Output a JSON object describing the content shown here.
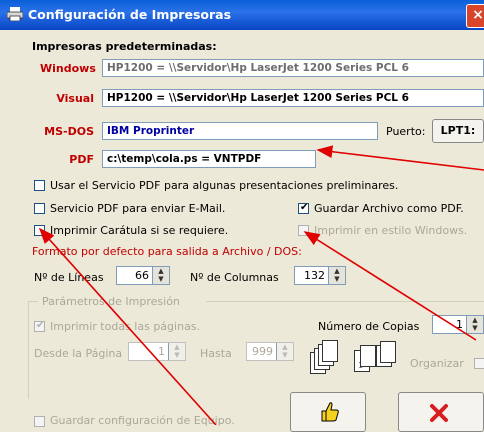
{
  "window": {
    "title": "Configuración de Impresoras",
    "close_glyph": "×"
  },
  "section_title": "Impresoras predeterminadas:",
  "printers": {
    "windows_label": "Windows",
    "windows_value": "HP1200 = \\\\Servidor\\Hp LaserJet 1200 Series PCL 6",
    "visual_label": "Visual",
    "visual_value": "HP1200 = \\\\Servidor\\Hp LaserJet 1200 Series PCL 6",
    "msdos_label": "MS-DOS",
    "msdos_value": "IBM Proprinter",
    "port_label": "Puerto:",
    "port_value": "LPT1:",
    "pdf_label": "PDF",
    "pdf_value": "c:\\temp\\cola.ps = VNTPDF"
  },
  "options": {
    "use_pdf_service": "Usar el Servicio PDF para algunas presentaciones preliminares.",
    "pdf_email": "Servicio PDF para enviar E-Mail.",
    "save_as_pdf": "Guardar Archivo como PDF.",
    "print_cover": "Imprimir Carátula si se requiere.",
    "print_windows_style": "Imprimir en estilo Windows."
  },
  "default_format_title": "Formato por defecto para salida a Archivo / DOS:",
  "format": {
    "lines_label": "Nº de Líneas",
    "lines_value": "66",
    "cols_label": "Nº de Columnas",
    "cols_value": "132"
  },
  "print_params": {
    "group_title": "Parámetros de Impresión",
    "print_all_pages": "Imprimir todas las páginas.",
    "copies_label": "Número de Copias",
    "copies_value": "1",
    "from_label": "Desde la Página",
    "from_value": "1",
    "to_label": "Hasta",
    "to_value": "999",
    "collate_label": "Organizar",
    "doc_num_1": "1",
    "doc_num_2": "2"
  },
  "footer": {
    "save_config_label": "Guardar configuración de Equipo."
  },
  "icons": {
    "ok": "thumbs-up-icon",
    "cancel": "red-x-icon"
  },
  "colors": {
    "accent_red": "#C00000",
    "title_blue": "#0A5FD8",
    "pdf_value_blue": "#0000A0"
  }
}
